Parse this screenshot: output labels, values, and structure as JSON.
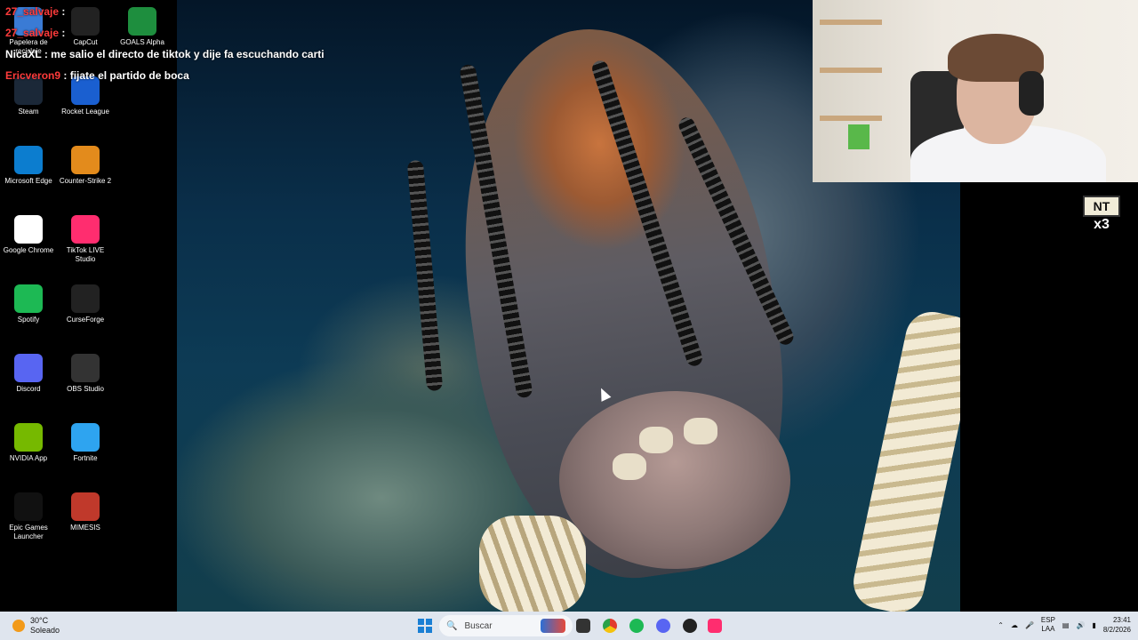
{
  "desktop": {
    "icons": [
      {
        "label": "Papelera de reciclaje",
        "icon": "recycle-bin-icon"
      },
      {
        "label": "CapCut",
        "icon": "capcut-icon"
      },
      {
        "label": "GOALS Alpha",
        "icon": "goals-icon"
      },
      {
        "label": "Steam",
        "icon": "steam-icon"
      },
      {
        "label": "Rocket League",
        "icon": "rocket-league-icon"
      },
      {
        "label": "Microsoft Edge",
        "icon": "edge-icon"
      },
      {
        "label": "Counter-Strike 2",
        "icon": "counter-strike-icon"
      },
      {
        "label": "Google Chrome",
        "icon": "chrome-icon"
      },
      {
        "label": "TikTok LIVE Studio",
        "icon": "tiktok-icon"
      },
      {
        "label": "Spotify",
        "icon": "spotify-icon"
      },
      {
        "label": "CurseForge",
        "icon": "curseforge-icon"
      },
      {
        "label": "Discord",
        "icon": "discord-icon"
      },
      {
        "label": "OBS Studio",
        "icon": "obs-icon"
      },
      {
        "label": "NVIDIA App",
        "icon": "nvidia-icon"
      },
      {
        "label": "Fortnite",
        "icon": "fortnite-icon"
      },
      {
        "label": "Epic Games Launcher",
        "icon": "epic-games-icon"
      },
      {
        "label": "MIMESIS",
        "icon": "mimesis-icon"
      }
    ]
  },
  "chat": [
    {
      "user": "27_salvaje",
      "msg": ":",
      "user_color": "#ff3b3b"
    },
    {
      "user": "27_salvaje",
      "msg": ":",
      "user_color": "#ff3b3b"
    },
    {
      "user": "NicaXL",
      "msg": ": me salio el directo de tiktok y dije fa  escuchando carti",
      "user_color": "#ffffff"
    },
    {
      "user": "Ericveron9",
      "msg": ": fijate el partido de boca",
      "user_color": "#ff3b3b"
    }
  ],
  "overlay": {
    "badge_text": "NT",
    "multiplier": "x3"
  },
  "taskbar": {
    "weather_temp": "30°C",
    "weather_desc": "Soleado",
    "search_placeholder": "Buscar",
    "lang_top": "ESP",
    "lang_bottom": "LAA",
    "time": "23:41",
    "date": "8/2/2026"
  },
  "colors": {
    "taskbar_bg": "#dfe5ee",
    "chat_user_red": "#ff3b3b"
  }
}
